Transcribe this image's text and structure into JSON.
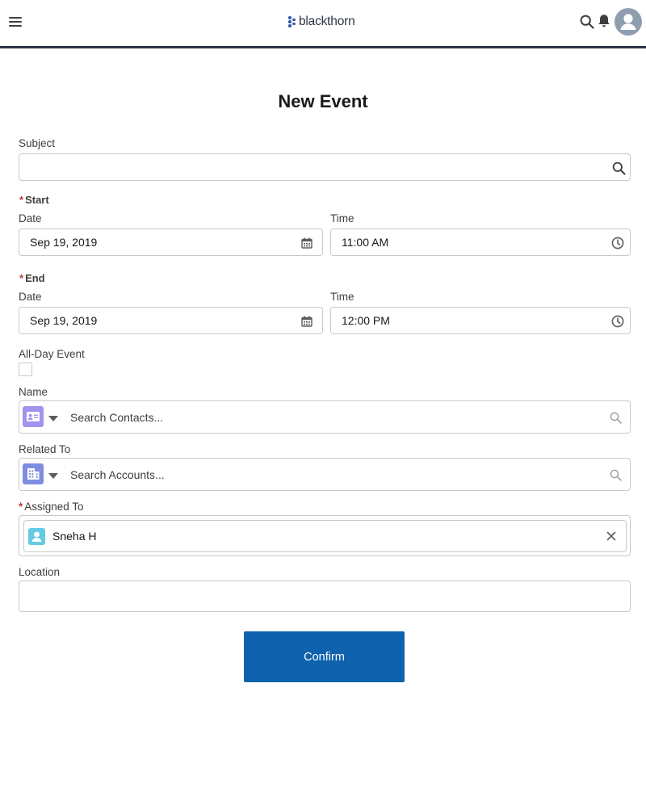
{
  "header": {
    "menu_icon": "hamburger-menu-icon",
    "logo_text": "blackthorn",
    "search_icon": "search-icon",
    "notifications_icon": "bell-icon",
    "avatar_icon": "user-avatar-icon"
  },
  "form": {
    "title": "New Event",
    "subject": {
      "label": "Subject",
      "value": ""
    },
    "start": {
      "label": "Start",
      "required": "*",
      "date_label": "Date",
      "date_value": "Sep 19, 2019",
      "time_label": "Time",
      "time_value": "11:00 AM"
    },
    "end": {
      "label": "End",
      "required": "*",
      "date_label": "Date",
      "date_value": "Sep 19, 2019",
      "time_label": "Time",
      "time_value": "12:00 PM"
    },
    "all_day": {
      "label": "All-Day Event",
      "checked": false
    },
    "name": {
      "label": "Name",
      "placeholder": "Search Contacts..."
    },
    "related_to": {
      "label": "Related To",
      "placeholder": "Search Accounts..."
    },
    "assigned_to": {
      "label": "Assigned To",
      "required": "*",
      "value": "Sneha H"
    },
    "location": {
      "label": "Location",
      "value": ""
    },
    "confirm_label": "Confirm"
  },
  "colors": {
    "accent": "#0f62ad",
    "required": "#c23934",
    "contact_icon_bg": "#a094ed",
    "account_icon_bg": "#7f8de1",
    "user_icon_bg": "#65cae4",
    "header_line": "#2b3445"
  }
}
